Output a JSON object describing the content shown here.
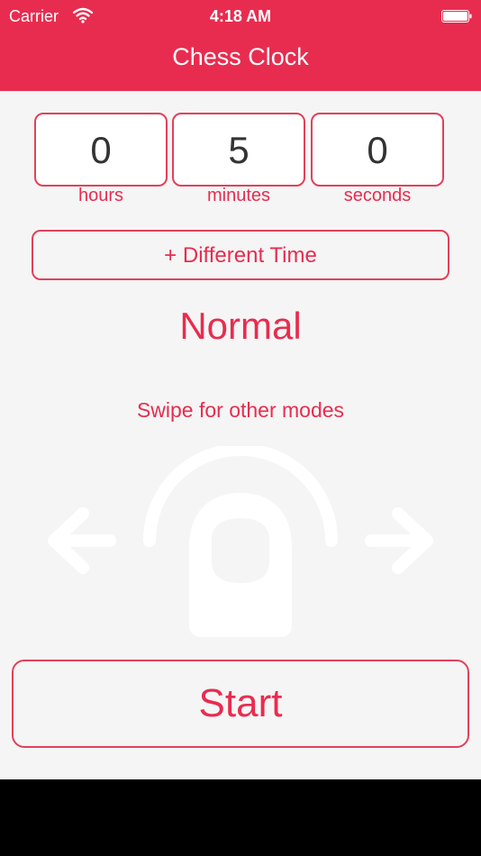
{
  "status_bar": {
    "carrier": "Carrier",
    "time": "4:18 AM",
    "wifi_icon": "wifi-icon",
    "battery_icon": "battery-icon"
  },
  "header": {
    "title": "Chess Clock",
    "background": "#e82c4f"
  },
  "time_setting": {
    "hours": {
      "value": "0",
      "label": "hours"
    },
    "minutes": {
      "value": "5",
      "label": "minutes"
    },
    "seconds": {
      "value": "0",
      "label": "seconds"
    }
  },
  "different_time_button": "+ Different Time",
  "mode": {
    "name": "Normal",
    "hint": "Swipe for other modes",
    "gesture_icon": "swipe-gesture-icon"
  },
  "start_button": "Start",
  "colors": {
    "accent": "#e82c4f",
    "background": "#f5f5f5"
  }
}
